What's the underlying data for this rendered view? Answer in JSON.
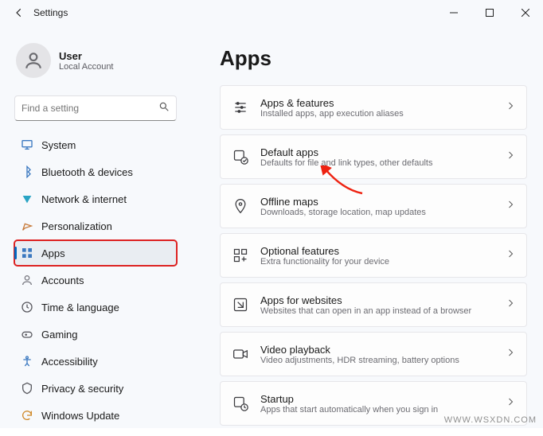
{
  "titlebar": {
    "title": "Settings"
  },
  "profile": {
    "name": "User",
    "subtitle": "Local Account"
  },
  "search": {
    "placeholder": "Find a setting"
  },
  "nav": [
    {
      "id": "system",
      "label": "System",
      "color": "#3a78c0",
      "selected": false
    },
    {
      "id": "bluetooth",
      "label": "Bluetooth & devices",
      "color": "#3a78c0",
      "selected": false
    },
    {
      "id": "network",
      "label": "Network & internet",
      "color": "#2aa4c4",
      "selected": false
    },
    {
      "id": "personalization",
      "label": "Personalization",
      "color": "#c77a3a",
      "selected": false
    },
    {
      "id": "apps",
      "label": "Apps",
      "color": "#3a78c0",
      "selected": true,
      "highlighted": true
    },
    {
      "id": "accounts",
      "label": "Accounts",
      "color": "#7a7a82",
      "selected": false
    },
    {
      "id": "time",
      "label": "Time & language",
      "color": "#5a5a60",
      "selected": false
    },
    {
      "id": "gaming",
      "label": "Gaming",
      "color": "#5a5a60",
      "selected": false
    },
    {
      "id": "accessibility",
      "label": "Accessibility",
      "color": "#3a78c0",
      "selected": false
    },
    {
      "id": "privacy",
      "label": "Privacy & security",
      "color": "#5a5a60",
      "selected": false
    },
    {
      "id": "update",
      "label": "Windows Update",
      "color": "#d08a2a",
      "selected": false
    }
  ],
  "page": {
    "title": "Apps"
  },
  "cards": [
    {
      "id": "apps-features",
      "title": "Apps & features",
      "subtitle": "Installed apps, app execution aliases"
    },
    {
      "id": "default-apps",
      "title": "Default apps",
      "subtitle": "Defaults for file and link types, other defaults"
    },
    {
      "id": "offline-maps",
      "title": "Offline maps",
      "subtitle": "Downloads, storage location, map updates"
    },
    {
      "id": "optional-features",
      "title": "Optional features",
      "subtitle": "Extra functionality for your device"
    },
    {
      "id": "apps-websites",
      "title": "Apps for websites",
      "subtitle": "Websites that can open in an app instead of a browser"
    },
    {
      "id": "video-playback",
      "title": "Video playback",
      "subtitle": "Video adjustments, HDR streaming, battery options"
    },
    {
      "id": "startup",
      "title": "Startup",
      "subtitle": "Apps that start automatically when you sign in"
    }
  ],
  "watermark": "WWW.WSXDN.COM"
}
